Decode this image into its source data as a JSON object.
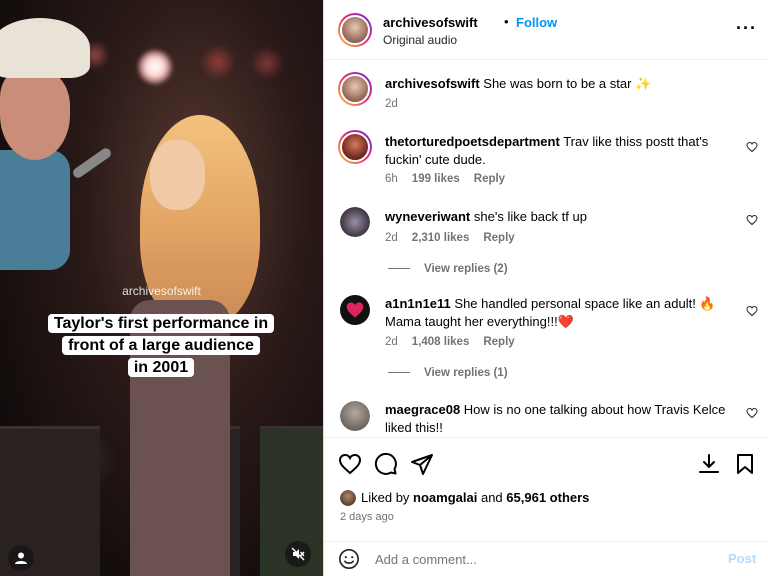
{
  "video": {
    "watermark": "archivesofswift",
    "caption_lines": [
      "Taylor's first performance in",
      "front of a large audience",
      "in 2001"
    ]
  },
  "header": {
    "username": "archivesofswift",
    "separator": "•",
    "follow_label": "Follow",
    "audio": "Original audio",
    "more_icon": "more-horizontal-icon"
  },
  "caption_comment": {
    "user": "archivesofswift",
    "text": "She was born to be a star ✨",
    "time": "2d"
  },
  "comments": [
    {
      "user": "thetorturedpoetsdepartment",
      "text": "Trav like thiss postt that's fuckin' cute dude.",
      "time": "6h",
      "likes": "199 likes",
      "reply": "Reply"
    },
    {
      "user": "wyneveriwant",
      "text": "she's like back tf up",
      "time": "2d",
      "likes": "2,310 likes",
      "reply": "Reply",
      "view_replies": "View replies (2)"
    },
    {
      "user": "a1n1n1e11",
      "text": "She handled personal space like an adult! 🔥 Mama taught her everything!!!❤️",
      "time": "2d",
      "likes": "1,408 likes",
      "reply": "Reply",
      "view_replies": "View replies (1)"
    },
    {
      "user": "maegrace08",
      "text": "How is no one talking about how Travis Kelce liked this!!"
    }
  ],
  "actions": {
    "icons": [
      "heart-icon",
      "comment-icon",
      "share-icon",
      "download-icon",
      "bookmark-icon"
    ],
    "liked_prefix": "Liked by",
    "liked_user": "noamgalai",
    "liked_and": "and",
    "liked_others": "65,961 others",
    "ago": "2 days ago"
  },
  "add_comment": {
    "placeholder": "Add a comment...",
    "post_label": "Post",
    "emoji_icon": "smiley-icon"
  },
  "colors": {
    "accent": "#0095f6",
    "muted": "#737373",
    "post_disabled": "#b3dbff"
  }
}
